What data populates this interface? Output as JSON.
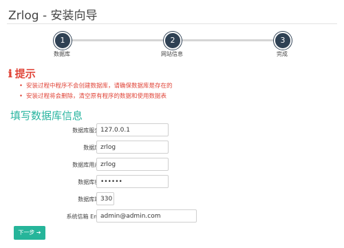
{
  "header": {
    "title": "Zrlog - 安装向导"
  },
  "steps": [
    {
      "number": "1",
      "label": "数据库"
    },
    {
      "number": "2",
      "label": "网站信息"
    },
    {
      "number": "3",
      "label": "完成"
    }
  ],
  "tips": {
    "icon": "info-icon",
    "icon_glyph": "ℹ",
    "title": "提示",
    "items": [
      "安装过程中程序不会创建数据库，请确保数据库是存在的",
      "安装过程将会删除，清空原有程序的数据和使用数据表"
    ]
  },
  "form": {
    "title": "填写数据库信息",
    "fields": [
      {
        "label": "数据库服务器:",
        "value": "127.0.0.1"
      },
      {
        "label": "数据库名:",
        "value": "zrlog"
      },
      {
        "label": "数据库用户名:",
        "value": "zrlog"
      },
      {
        "label": "数据库密码:",
        "value": "••••••"
      },
      {
        "label": "数据库端口:",
        "value": "330"
      },
      {
        "label": "系统信箱 Email:",
        "value": "admin@admin.com"
      }
    ],
    "next_label": "下一步 ➔"
  },
  "colors": {
    "step": "#2f4154",
    "tip": "#e0463a",
    "accent": "#26b59a"
  }
}
